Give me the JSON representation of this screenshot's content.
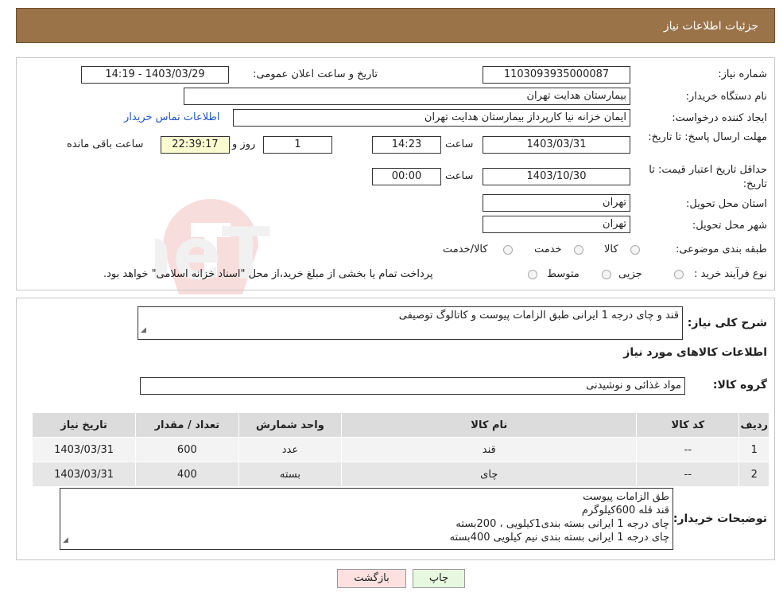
{
  "header": {
    "title": "جزئیات اطلاعات نیاز"
  },
  "watermark": {
    "text": "AriaTender.neT"
  },
  "form": {
    "need_number_label": "شماره نیاز:",
    "need_number": "1103093935000087",
    "announce_label": "تاریخ و ساعت اعلان عمومی:",
    "announce_value": "1403/03/29 - 14:19",
    "buyer_org_label": "نام دستگاه خریدار:",
    "buyer_org": "بیمارستان هدایت تهران",
    "creator_label": "ایجاد کننده درخواست:",
    "creator": "ایمان خزانه نیا کارپرداز بیمارستان هدایت تهران",
    "contact_link": "اطلاعات تماس خریدار",
    "deadline_label": "مهلت ارسال پاسخ: تا تاریخ:",
    "deadline_date": "1403/03/31",
    "time_label": "ساعت",
    "deadline_time": "14:23",
    "days_value": "1",
    "days_label": "روز و",
    "remaining_time": "22:39:17",
    "remaining_label": "ساعت باقی مانده",
    "validity_label": "حداقل تاریخ اعتبار قیمت: تا تاریخ:",
    "validity_date": "1403/10/30",
    "validity_time": "00:00",
    "province_label": "استان محل تحویل:",
    "province": "تهران",
    "city_label": "شهر محل تحویل:",
    "city": "تهران",
    "category_label": "طبقه بندی موضوعی:",
    "category_options": [
      "کالا",
      "خدمت",
      "کالا/خدمت"
    ],
    "process_label": "نوع فرآیند خرید :",
    "process_options": [
      "جزیی",
      "متوسط"
    ],
    "process_note": "پرداخت تمام یا بخشی از مبلغ خرید،از محل \"اسناد خزانه اسلامی\" خواهد بود."
  },
  "details": {
    "summary_label": "شرح کلی نیاز:",
    "summary": "قند و چای درجه 1 ایرانی طبق الزامات پیوست و کاتالوگ توصیفی",
    "goods_title": "اطلاعات کالاهای مورد نیاز",
    "group_label": "گروه کالا:",
    "group": "مواد غذائی و نوشیدنی",
    "table": {
      "headers": [
        "ردیف",
        "کد کالا",
        "نام کالا",
        "واحد شمارش",
        "تعداد / مقدار",
        "تاریخ نیاز"
      ],
      "rows": [
        [
          "1",
          "--",
          "قند",
          "عدد",
          "600",
          "1403/03/31"
        ],
        [
          "2",
          "--",
          "چای",
          "بسته",
          "400",
          "1403/03/31"
        ]
      ]
    },
    "buyer_notes_label": "توضیحات خریدار:",
    "buyer_notes": [
      "طق الزامات پیوست",
      "قند قله 600کیلوگرم",
      "چای درجه 1 ایرانی بسته بندی1کیلویی ، 200بسته",
      "چای درجه 1 ایرانی بسته بندی نیم کیلویی 400بسته"
    ]
  },
  "buttons": {
    "print": "چاپ",
    "back": "بازگشت"
  },
  "colors": {
    "header_bg": "#9b7348",
    "remaining_bg": "#fbfbd0",
    "print_bg": "#e8f8e0",
    "back_bg": "#fde0e0",
    "link": "#2255cc"
  }
}
